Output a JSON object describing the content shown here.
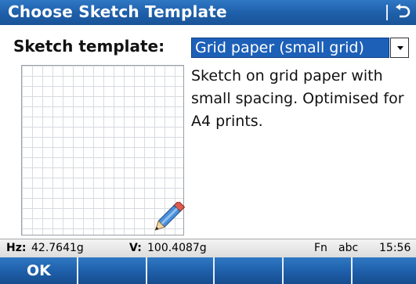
{
  "title": "Choose Sketch Template",
  "icons": {
    "back": "back-arrow-icon",
    "pencil": "pencil-icon"
  },
  "form": {
    "label": "Sketch template:",
    "selected_template": "Grid paper (small grid)",
    "description": "Sketch on grid paper with small spacing. Optimised for A4 prints."
  },
  "status": {
    "hz_label": "Hz:",
    "hz_value": "42.7641g",
    "v_label": "V:",
    "v_value": "100.4087g",
    "fn": "Fn",
    "input_mode": "abc",
    "time": "15:56"
  },
  "softkeys": [
    "OK",
    "",
    "",
    "",
    "",
    ""
  ],
  "colors": {
    "accent": "#1e5ea8",
    "selection": "#1d60b8"
  }
}
